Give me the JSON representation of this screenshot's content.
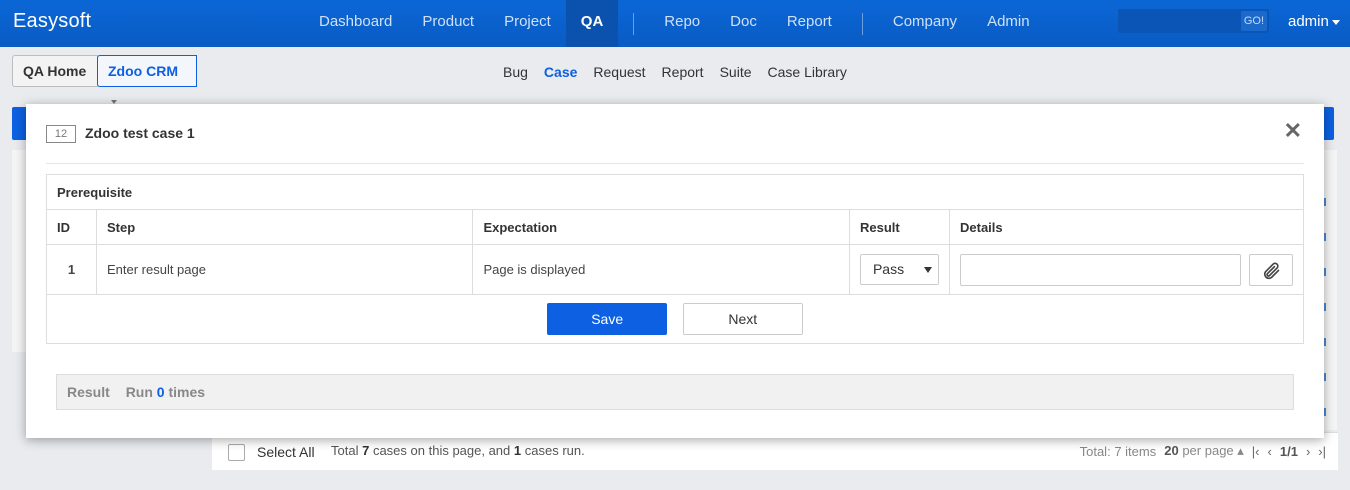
{
  "topbar": {
    "brand": "Easysoft",
    "nav_group1": [
      "Dashboard",
      "Product",
      "Project",
      "QA"
    ],
    "nav_group2": [
      "Repo",
      "Doc",
      "Report"
    ],
    "nav_group3": [
      "Company",
      "Admin"
    ],
    "active": "QA",
    "search_button": "GO!",
    "user": "admin",
    "colors": {
      "bar": "#0a5bc3",
      "accent": "#0c60e1"
    }
  },
  "breadcrumb": {
    "home": "QA Home",
    "product": "Zdoo CRM"
  },
  "subnav": {
    "items": [
      "Bug",
      "Case",
      "Request",
      "Report",
      "Suite",
      "Case Library"
    ],
    "active": "Case"
  },
  "modal": {
    "case_id": "12",
    "title": "Zdoo test case 1",
    "prerequisite_label": "Prerequisite",
    "columns": [
      "ID",
      "Step",
      "Expectation",
      "Result",
      "Details"
    ],
    "steps": [
      {
        "id": "1",
        "step": "Enter result page",
        "expectation": "Page is displayed",
        "result": "Pass",
        "details": ""
      }
    ],
    "save_label": "Save",
    "next_label": "Next",
    "result_label": "Result",
    "run_prefix": "Run",
    "run_count": "0",
    "run_suffix": "times"
  },
  "footer": {
    "select_all": "Select All",
    "summary_prefix": "Total",
    "summary_count": "7",
    "summary_mid": "cases on this page, and",
    "summary_run": "1",
    "summary_suffix": "cases run.",
    "total_prefix": "Total:",
    "total_count": "7",
    "total_suffix": "items",
    "per_page": "20",
    "per_page_suffix": "per page",
    "page": "1/1"
  }
}
